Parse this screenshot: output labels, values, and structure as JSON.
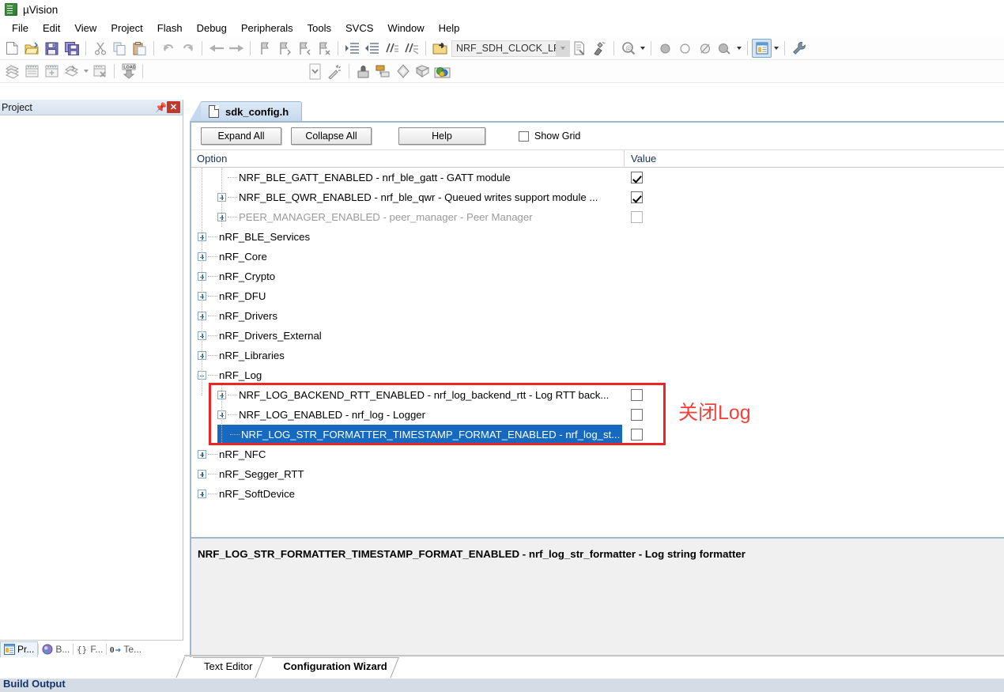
{
  "window": {
    "title": "µVision",
    "app_icon": "uvision-icon"
  },
  "menubar": {
    "items": [
      "File",
      "Edit",
      "View",
      "Project",
      "Flash",
      "Debug",
      "Peripherals",
      "Tools",
      "SVCS",
      "Window",
      "Help"
    ]
  },
  "toolbar_main": {
    "target_combo_value": "NRF_SDH_CLOCK_LF_SRC",
    "icons": [
      "new-file-icon",
      "open-folder-icon",
      "save-icon",
      "save-all-icon",
      "cut-icon",
      "copy-icon",
      "paste-icon",
      "undo-icon",
      "redo-icon",
      "navigate-back-icon",
      "navigate-forward-icon",
      "bookmark-toggle-icon",
      "bookmark-prev-icon",
      "bookmark-next-icon",
      "bookmark-clear-icon",
      "indent-icon",
      "outdent-icon",
      "comment-icon",
      "uncomment-icon",
      "target-options-icon",
      "files-icon",
      "manage-components-icon",
      "find-in-files-icon",
      "debug-start-icon",
      "breakpoint-icon",
      "breakpoint-disable-icon",
      "breakpoint-kill-icon",
      "breakpoint-disable-all-icon",
      "window-layout-icon",
      "configure-icon"
    ]
  },
  "toolbar_build": {
    "icons": [
      "translate-icon",
      "build-icon",
      "rebuild-icon",
      "batch-build-icon",
      "stop-build-icon",
      "load-icon",
      "target-select-icon",
      "magic-wand-icon",
      "manage-project-icon",
      "multi-project-icon",
      "pack-installer-icon",
      "run-to-main-icon",
      "pack-icon"
    ],
    "load_label": "LOAD"
  },
  "project_panel": {
    "title": "Project",
    "pin_icon": "pin-icon",
    "close_icon": "close-icon",
    "tabs": [
      {
        "label": "Pr...",
        "icon": "project-icon",
        "selected": true
      },
      {
        "label": "B...",
        "icon": "books-icon",
        "selected": false
      },
      {
        "label": "F...",
        "icon": "functions-icon",
        "selected": false
      },
      {
        "label": "Te...",
        "icon": "templates-icon",
        "selected": false
      }
    ]
  },
  "document_tab": {
    "label": "sdk_config.h",
    "icon": "file-icon"
  },
  "wizard": {
    "buttons": {
      "expand_all": "Expand All",
      "collapse_all": "Collapse All",
      "help": "Help"
    },
    "show_grid": {
      "label": "Show Grid",
      "checked": false
    },
    "columns": {
      "option": "Option",
      "value": "Value"
    },
    "rows": [
      {
        "label": "NRF_BLE_GATT_ENABLED  - nrf_ble_gatt - GATT module",
        "level": 2,
        "expander": "none",
        "value": "checkbox",
        "checked": true,
        "dim": false,
        "selected": false
      },
      {
        "label": "NRF_BLE_QWR_ENABLED - nrf_ble_qwr - Queued writes support module ...",
        "level": 2,
        "expander": "plus",
        "value": "checkbox",
        "checked": true,
        "dim": false,
        "selected": false
      },
      {
        "label": "PEER_MANAGER_ENABLED - peer_manager - Peer Manager",
        "level": 2,
        "expander": "plus",
        "value": "checkbox",
        "checked": false,
        "dim": true,
        "selected": false
      },
      {
        "label": "nRF_BLE_Services",
        "level": 1,
        "expander": "plus",
        "value": "none",
        "checked": false,
        "dim": false,
        "selected": false
      },
      {
        "label": "nRF_Core",
        "level": 1,
        "expander": "plus",
        "value": "none",
        "checked": false,
        "dim": false,
        "selected": false
      },
      {
        "label": "nRF_Crypto",
        "level": 1,
        "expander": "plus",
        "value": "none",
        "checked": false,
        "dim": false,
        "selected": false
      },
      {
        "label": "nRF_DFU",
        "level": 1,
        "expander": "plus",
        "value": "none",
        "checked": false,
        "dim": false,
        "selected": false
      },
      {
        "label": "nRF_Drivers",
        "level": 1,
        "expander": "plus",
        "value": "none",
        "checked": false,
        "dim": false,
        "selected": false
      },
      {
        "label": "nRF_Drivers_External",
        "level": 1,
        "expander": "plus",
        "value": "none",
        "checked": false,
        "dim": false,
        "selected": false
      },
      {
        "label": "nRF_Libraries",
        "level": 1,
        "expander": "plus",
        "value": "none",
        "checked": false,
        "dim": false,
        "selected": false
      },
      {
        "label": "nRF_Log",
        "level": 1,
        "expander": "minus",
        "value": "none",
        "checked": false,
        "dim": false,
        "selected": false
      },
      {
        "label": "NRF_LOG_BACKEND_RTT_ENABLED - nrf_log_backend_rtt - Log RTT back...",
        "level": 2,
        "expander": "plus",
        "value": "checkbox",
        "checked": false,
        "dim": false,
        "selected": false
      },
      {
        "label": "NRF_LOG_ENABLED - nrf_log - Logger",
        "level": 2,
        "expander": "plus",
        "value": "checkbox",
        "checked": false,
        "dim": false,
        "selected": false
      },
      {
        "label": "NRF_LOG_STR_FORMATTER_TIMESTAMP_FORMAT_ENABLED  - nrf_log_st...",
        "level": 2,
        "expander": "none",
        "value": "checkbox",
        "checked": false,
        "dim": false,
        "selected": true
      },
      {
        "label": "nRF_NFC",
        "level": 1,
        "expander": "plus",
        "value": "none",
        "checked": false,
        "dim": false,
        "selected": false
      },
      {
        "label": "nRF_Segger_RTT",
        "level": 1,
        "expander": "plus",
        "value": "none",
        "checked": false,
        "dim": false,
        "selected": false
      },
      {
        "label": "nRF_SoftDevice",
        "level": 1,
        "expander": "plus",
        "value": "none",
        "checked": false,
        "dim": false,
        "selected": false
      }
    ],
    "description": "NRF_LOG_STR_FORMATTER_TIMESTAMP_FORMAT_ENABLED  - nrf_log_str_formatter - Log string formatter"
  },
  "annotation": {
    "text": "关闭Log",
    "color": "#f2443c",
    "box_color": "#ef2424"
  },
  "editor_tabs": [
    {
      "label": "Text Editor",
      "selected": false
    },
    {
      "label": "Configuration Wizard",
      "selected": true
    }
  ],
  "statusbar": {
    "text": "Build Output"
  },
  "colors": {
    "selection_blue": "#1669c1",
    "header_text": "#16335c",
    "panel_gradient_top": "#e8eff7",
    "panel_gradient_bottom": "#d6e2ef",
    "annotation_red": "#f2443c"
  }
}
